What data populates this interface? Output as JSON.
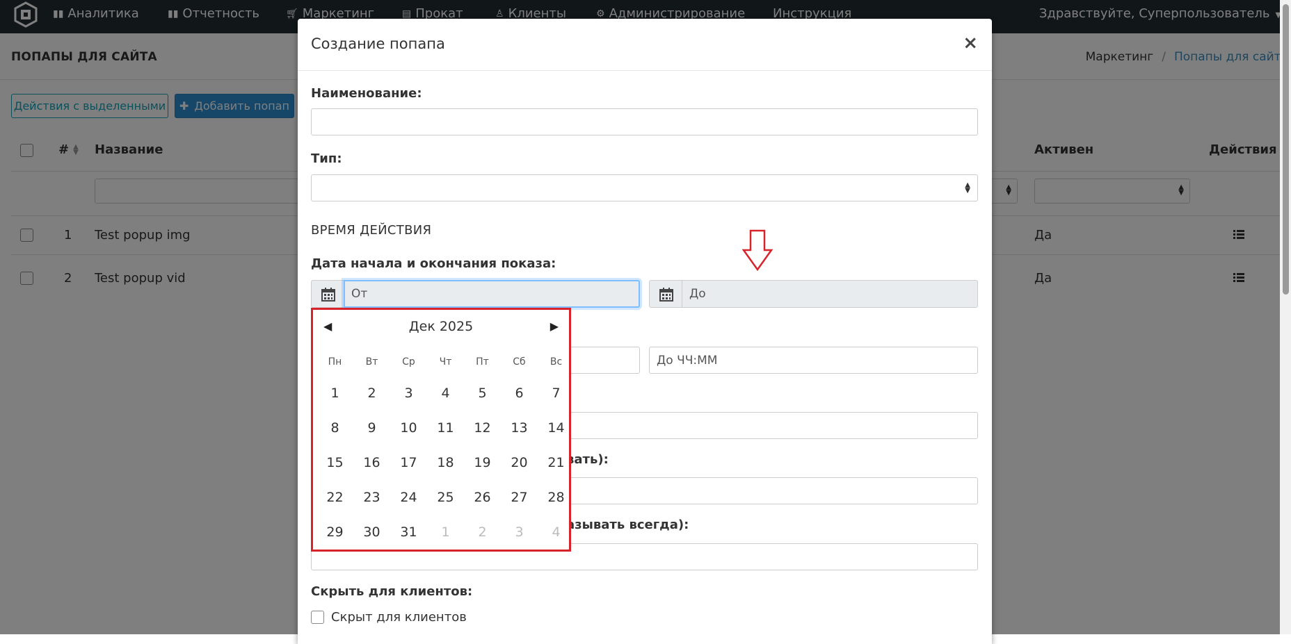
{
  "navbar": {
    "items": [
      {
        "label": "Аналитика",
        "icon": "bar-chart-icon"
      },
      {
        "label": "Отчетность",
        "icon": "bar-chart-icon"
      },
      {
        "label": "Маркетинг",
        "icon": "cart-icon"
      },
      {
        "label": "Прокат",
        "icon": "book-icon"
      },
      {
        "label": "Клиенты",
        "icon": "user-icon"
      },
      {
        "label": "Администрирование",
        "icon": "cogs-icon"
      },
      {
        "label": "Инструкция",
        "icon": ""
      }
    ],
    "greeting": "Здравствуйте, Суперпользователь"
  },
  "page": {
    "title": "ПОПАПЫ ДЛЯ САЙТА",
    "breadcrumb": {
      "parent": "Маркетинг",
      "current": "Попапы для сайта"
    },
    "bulk_actions_label": "Действия с выделенными",
    "add_button_label": "Добавить попап",
    "table": {
      "headers": {
        "num": "#",
        "name": "Название",
        "active": "Активен",
        "actions": "Действия"
      },
      "rows": [
        {
          "num": "1",
          "name": "Test popup img",
          "active": "Да"
        },
        {
          "num": "2",
          "name": "Test popup vid",
          "active": "Да"
        }
      ]
    }
  },
  "modal": {
    "title": "Создание попапа",
    "close_symbol": "×",
    "name_label": "Наименование:",
    "type_label": "Тип:",
    "section_time": "ВРЕМЯ ДЕЙСТВИЯ",
    "date_range_label": "Дата начала и окончания показа:",
    "date_from_placeholder": "От",
    "date_to_placeholder": "До",
    "time_to_placeholder": "До ЧЧ:ММ",
    "partial_label_1": "вать):",
    "partial_label_2": "азывать всегда):",
    "hide_for_clients_label": "Скрыть для клиентов:",
    "hide_checkbox_label": "Скрыт для клиентов"
  },
  "datepicker": {
    "month_title": "Дек 2025",
    "prev_symbol": "◀",
    "next_symbol": "▶",
    "weekdays": [
      "Пн",
      "Вт",
      "Ср",
      "Чт",
      "Пт",
      "Сб",
      "Вс"
    ],
    "weeks": [
      [
        "1",
        "2",
        "3",
        "4",
        "5",
        "6",
        "7"
      ],
      [
        "8",
        "9",
        "10",
        "11",
        "12",
        "13",
        "14"
      ],
      [
        "15",
        "16",
        "17",
        "18",
        "19",
        "20",
        "21"
      ],
      [
        "22",
        "23",
        "24",
        "25",
        "26",
        "27",
        "28"
      ],
      [
        "29",
        "30",
        "31",
        "1",
        "2",
        "3",
        "4"
      ]
    ],
    "muted_from_last_week_index": 3
  },
  "colors": {
    "navbar_bg": "#222d32",
    "accent_blue": "#2c8fd0",
    "link_blue": "#3c8dbc",
    "annotation_red": "#d8232a"
  }
}
